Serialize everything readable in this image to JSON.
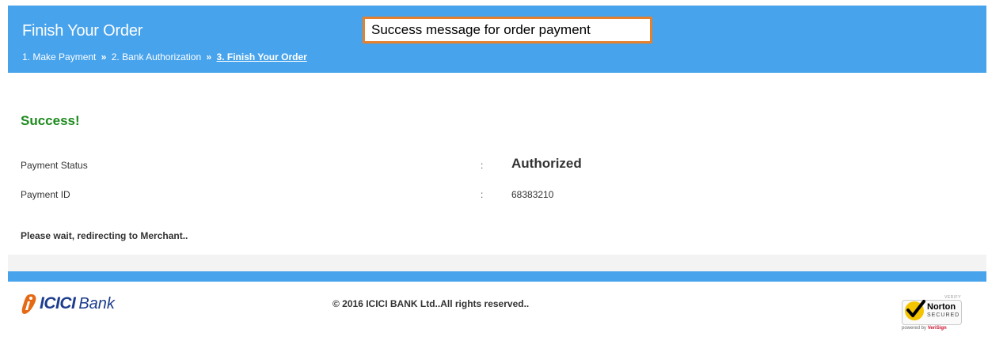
{
  "header": {
    "title": "Finish Your Order",
    "breadcrumb": {
      "step1": "1. Make Payment",
      "sep1": "»",
      "step2": "2. Bank Authorization",
      "sep2": "»",
      "step3": "3. Finish Your Order"
    }
  },
  "callout": {
    "text": "Success message for order payment"
  },
  "result": {
    "title": "Success!",
    "rows": [
      {
        "label": "Payment Status",
        "colon": ":",
        "value": "Authorized"
      },
      {
        "label": "Payment ID",
        "colon": ":",
        "value": "68383210"
      }
    ],
    "redirect_message": "Please wait, redirecting to Merchant.."
  },
  "footer": {
    "logo_text_1": "ICICI",
    "logo_text_2": "Bank",
    "copyright": "© 2016 ICICI BANK Ltd..All rights reserved..",
    "norton": {
      "verify": "VERIFY",
      "name": "Norton",
      "secured": "SECURED",
      "powered_prefix": "powered by",
      "powered_brand": "VeriSign"
    }
  },
  "colors": {
    "header_blue": "#47a3ec",
    "success_green": "#1d8a1d",
    "callout_border": "#e5802d",
    "icici_orange": "#e56a16",
    "icici_blue": "#1c3c8c",
    "norton_yellow": "#f5c400"
  },
  "icons": [
    "icici-logo-icon",
    "norton-check-icon"
  ]
}
